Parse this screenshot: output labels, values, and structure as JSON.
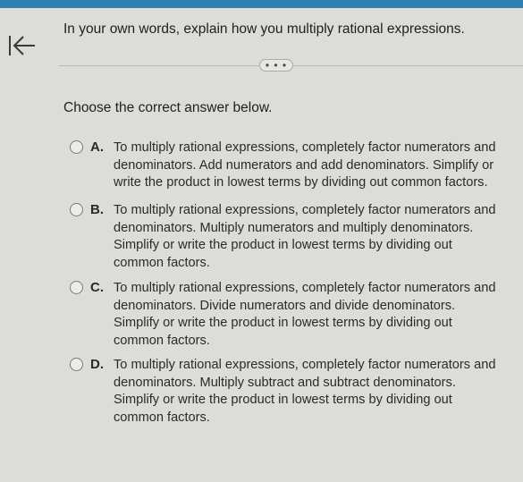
{
  "question": "In your own words, explain how you multiply rational expressions.",
  "more_label": "• • •",
  "instruction": "Choose the correct answer below.",
  "options": [
    {
      "letter": "A.",
      "lines": [
        "To multiply rational expressions, completely factor numerators and",
        "denominators. Add numerators and add denominators. Simplify or",
        "write the product in lowest terms by dividing out common factors."
      ]
    },
    {
      "letter": "B.",
      "lines": [
        "To multiply rational expressions, completely factor numerators and",
        "denominators. Multiply numerators and multiply denominators.",
        "Simplify or write the product in lowest terms by dividing out",
        "common factors."
      ]
    },
    {
      "letter": "C.",
      "lines": [
        "To multiply rational expressions, completely factor numerators and",
        "denominators. Divide numerators and divide denominators.",
        "Simplify or write the product in lowest terms by dividing out",
        "common factors."
      ]
    },
    {
      "letter": "D.",
      "lines": [
        "To multiply rational expressions, completely factor numerators and",
        "denominators. Multiply subtract and subtract denominators.",
        "Simplify or write the product in lowest terms by dividing out",
        "common factors."
      ]
    }
  ],
  "colors": {
    "background": "#dcdcd8",
    "top_bar": "#2f7fb3",
    "text": "#2a2a2a"
  }
}
